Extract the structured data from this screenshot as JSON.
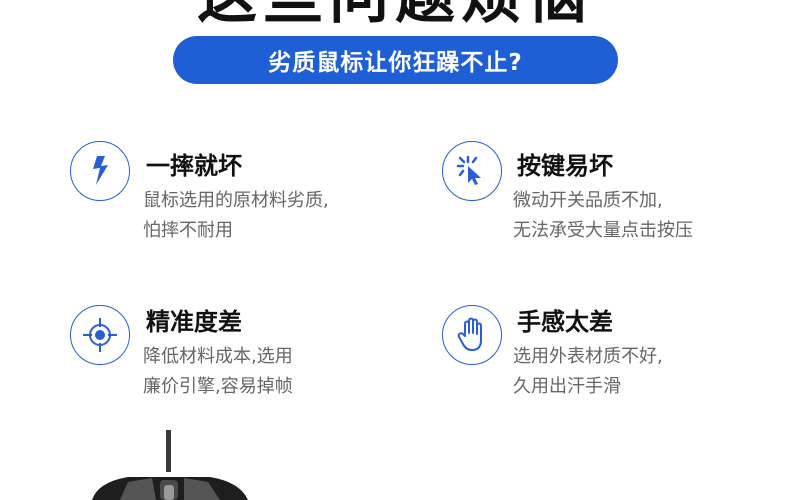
{
  "header": {
    "headline": "这些问题烦恼",
    "subtitle": "劣质鼠标让你狂躁不止?"
  },
  "features": [
    {
      "icon": "lightning-icon",
      "title": "一摔就坏",
      "desc_line1": "鼠标选用的原材料劣质,",
      "desc_line2": "怕摔不耐用"
    },
    {
      "icon": "click-cursor-icon",
      "title": "按键易坏",
      "desc_line1": "微动开关品质不加,",
      "desc_line2": "无法承受大量点击按压"
    },
    {
      "icon": "crosshair-icon",
      "title": "精准度差",
      "desc_line1": "降低材料成本,选用",
      "desc_line2": "廉价引擎,容易掉帧"
    },
    {
      "icon": "hand-icon",
      "title": "手感太差",
      "desc_line1": "选用外表材质不好,",
      "desc_line2": "久用出汗手滑"
    }
  ],
  "colors": {
    "accent": "#1f5fd6",
    "icon_stroke": "#2a5fd0",
    "title": "#111111",
    "desc": "#666666"
  }
}
